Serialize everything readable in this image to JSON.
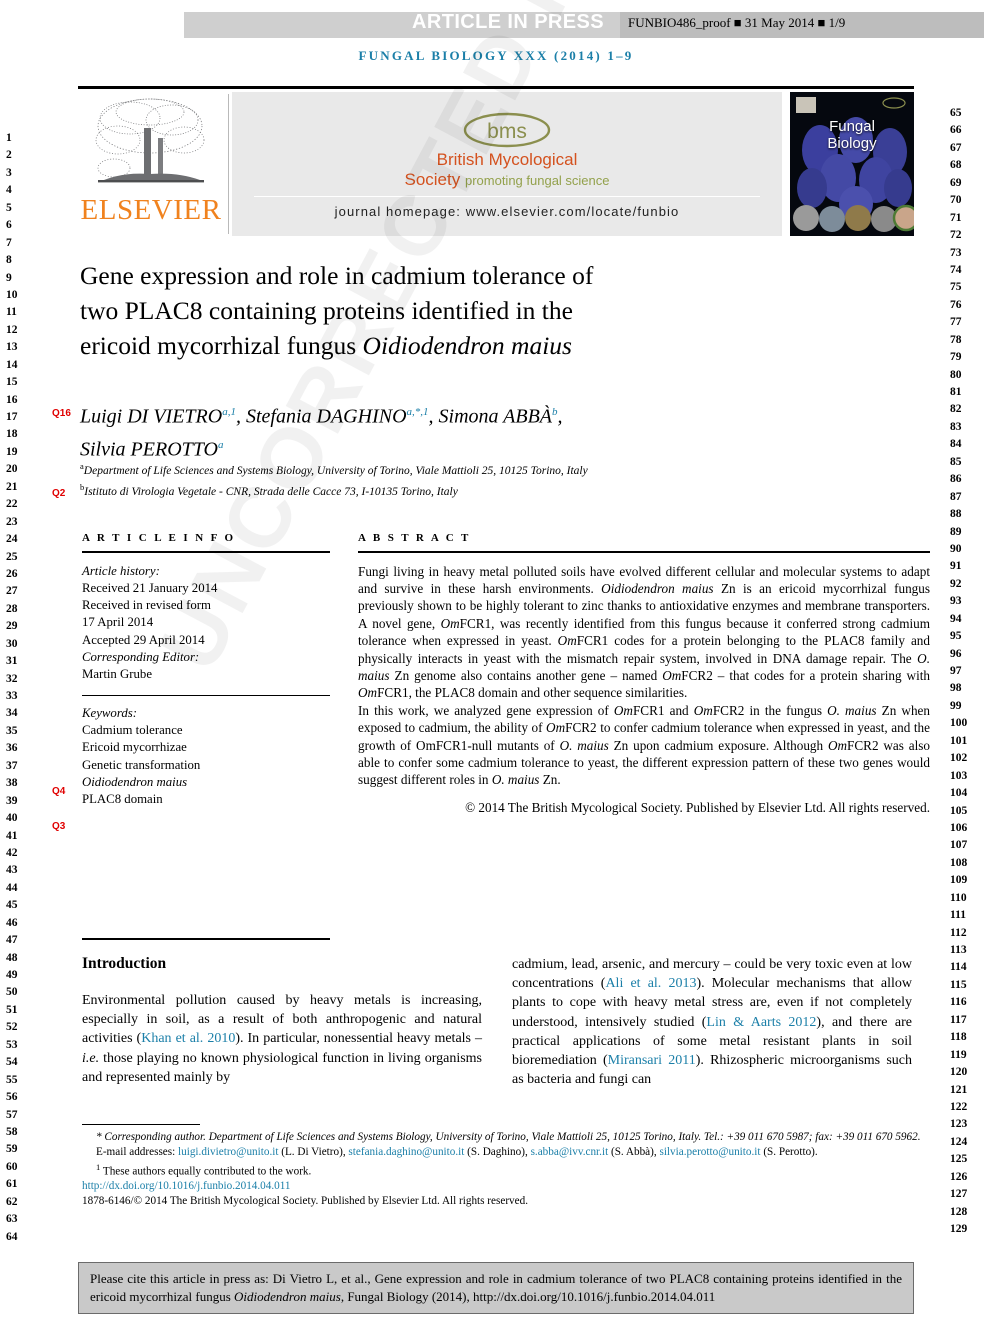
{
  "proof_header": {
    "article_in_press": "ARTICLE IN PRESS",
    "proof_meta": "FUNBIO486_proof ■ 31 May 2014 ■ 1/9",
    "journal_line": "FUNGAL BIOLOGY XXX (2014) 1–9"
  },
  "masthead": {
    "publisher_logo_text": "ELSEVIER",
    "society_logo_text": "bms",
    "society_name_line1": "British Mycological",
    "society_name_line2": "Society",
    "society_tagline": "promoting fungal science",
    "journal_homepage": "journal homepage: www.elsevier.com/locate/funbio",
    "cover_title_line1": "Fungal",
    "cover_title_line2": "Biology"
  },
  "article": {
    "title_line1": "Gene expression and role in cadmium tolerance of",
    "title_line2": "two PLAC8 containing proteins identified in the",
    "title_line3_pre": "ericoid mycorrhizal fungus ",
    "title_line3_italic": "Oidiodendron maius",
    "authors_line1": "Luigi DI VIETRO",
    "author2": "Stefania DAGHINO",
    "author3": "Simona ABBÀ",
    "author4": "Silvia PEROTTO",
    "affiliation_a": "Department of Life Sciences and Systems Biology, University of Torino, Viale Mattioli 25, 10125 Torino, Italy",
    "affiliation_b": "Istituto di Virologia Vegetale - CNR, Strada delle Cacce 73, I-10135 Torino, Italy",
    "query_markers": {
      "q16": "Q16",
      "q2": "Q2",
      "q4": "Q4",
      "q3": "Q3"
    }
  },
  "article_info": {
    "heading": "A R T I C L E  I N F O",
    "history_label": "Article history:",
    "received": "Received 21 January 2014",
    "revised_label": "Received in revised form",
    "revised_date": "17 April 2014",
    "accepted": "Accepted 29 April 2014",
    "editor_label": "Corresponding Editor:",
    "editor_name": "Martin Grube",
    "keywords_label": "Keywords:",
    "keyword1": "Cadmium tolerance",
    "keyword2": "Ericoid mycorrhizae",
    "keyword3": "Genetic transformation",
    "keyword4": "Oidiodendron maius",
    "keyword5": "PLAC8 domain"
  },
  "abstract": {
    "heading": "A B S T R A C T",
    "paragraph1_part1": "Fungi living in heavy metal polluted soils have evolved different cellular and molecular systems to adapt and survive in these harsh environments. ",
    "paragraph1_italic1": "Oidiodendron maius",
    "paragraph1_part2": " Zn is an ericoid mycorrhizal fungus previously shown to be highly tolerant to zinc thanks to antioxidative enzymes and membrane transporters. A novel gene, ",
    "paragraph1_italic2": "Om",
    "paragraph1_part3": "FCR1, was recently identified from this fungus because it conferred strong cadmium tolerance when expressed in yeast. ",
    "paragraph1_italic3": "Om",
    "paragraph1_part4": "FCR1 codes for a protein belonging to the PLAC8 family and physically interacts in yeast with the mismatch repair system, involved in DNA damage repair. The ",
    "paragraph1_italic4": "O. maius",
    "paragraph1_part5": " Zn genome also contains another gene – named ",
    "paragraph1_italic5": "Om",
    "paragraph1_part6": "FCR2 – that codes for a protein sharing with ",
    "paragraph1_italic6": "Om",
    "paragraph1_part7": "FCR1, the PLAC8 domain and other sequence similarities.",
    "paragraph2_part1": "In this work, we analyzed gene expression of ",
    "paragraph2_italic1": "Om",
    "paragraph2_part2": "FCR1 and ",
    "paragraph2_italic2": "Om",
    "paragraph2_part3": "FCR2 in the fungus ",
    "paragraph2_italic3": "O. maius",
    "paragraph2_part4": " Zn when exposed to cadmium, the ability of ",
    "paragraph2_italic4": "Om",
    "paragraph2_part5": "FCR2 to confer cadmium tolerance when expressed in yeast, and the growth of OmFCR1-null mutants of ",
    "paragraph2_italic5": "O. maius",
    "paragraph2_part6": " Zn upon cadmium exposure. Although ",
    "paragraph2_italic6": "Om",
    "paragraph2_part7": "FCR2 was also able to confer some cadmium tolerance to yeast, the different expression pattern of these two genes would suggest different roles in ",
    "paragraph2_italic7": "O. maius",
    "paragraph2_part8": " Zn.",
    "copyright": "© 2014 The British Mycological Society. Published by Elsevier Ltd. All rights reserved."
  },
  "introduction": {
    "heading": "Introduction",
    "left_part1": "Environmental pollution caused by heavy metals is increasing, especially in soil, as a result of both anthropogenic and natural activities (",
    "left_cite1": "Khan et al. 2010",
    "left_part2": "). In particular, nonessential heavy metals – ",
    "left_italic1": "i.e.",
    "left_part3": " those playing no known physiological function in living organisms and represented mainly by",
    "right_part1": "cadmium, lead, arsenic, and mercury – could be very toxic even at low concentrations (",
    "right_cite1": "Ali et al. 2013",
    "right_part2": "). Molecular mechanisms that allow plants to cope with heavy metal stress are, even if not completely understood, intensively studied (",
    "right_cite2": "Lin & Aarts 2012",
    "right_part3": "), and there are practical applications of some metal resistant plants in soil bioremediation (",
    "right_cite3": "Miransari 2011",
    "right_part4": "). Rhizospheric microorganisms such as bacteria and fungi can"
  },
  "footnotes": {
    "corresponding": "Corresponding author. Department of Life Sciences and Systems Biology, University of Torino, Viale Mattioli 25, 10125 Torino, Italy. Tel.: +39 011 670 5987; fax: +39 011 670 5962.",
    "email_label": "E-mail addresses:",
    "email1": "luigi.divietro@unito.it",
    "email1_who": "(L. Di Vietro),",
    "email2": "stefania.daghino@unito.it",
    "email2_who": "(S. Daghino),",
    "email3": "s.abba@ivv.cnr.it",
    "email3_who": "(S. Abbà),",
    "email4": "silvia.perotto@unito.it",
    "email4_who": "(S. Perotto).",
    "equal_contrib": "These authors equally contributed to the work.",
    "doi": "http://dx.doi.org/10.1016/j.funbio.2014.04.011",
    "issn_copyright": "1878-6146/© 2014 The British Mycological Society. Published by Elsevier Ltd. All rights reserved."
  },
  "citation_box": {
    "part1": "Please cite this article in press as: Di Vietro L, et al., Gene expression and role in cadmium tolerance of two PLAC8 containing proteins identified in the ericoid mycorrhizal fungus ",
    "italic": "Oidiodendron maius",
    "part2": ", Fungal Biology (2014), http://dx.doi.org/10.1016/j.funbio.2014.04.011"
  },
  "watermark": {
    "text": "UNCORRECTED PROOF"
  },
  "line_numbers": {
    "left_start": 1,
    "left_end": 64,
    "right_start": 65,
    "right_end": 129
  },
  "colors": {
    "journal_blue": "#1b7fa8",
    "elsevier_orange": "#f0821e",
    "bms_orange": "#d4521f",
    "bms_olive": "#93a14c",
    "query_red": "#e00000",
    "proof_bar_gray": "#cfcfcf",
    "citation_box_gray": "#c9c9c9"
  }
}
